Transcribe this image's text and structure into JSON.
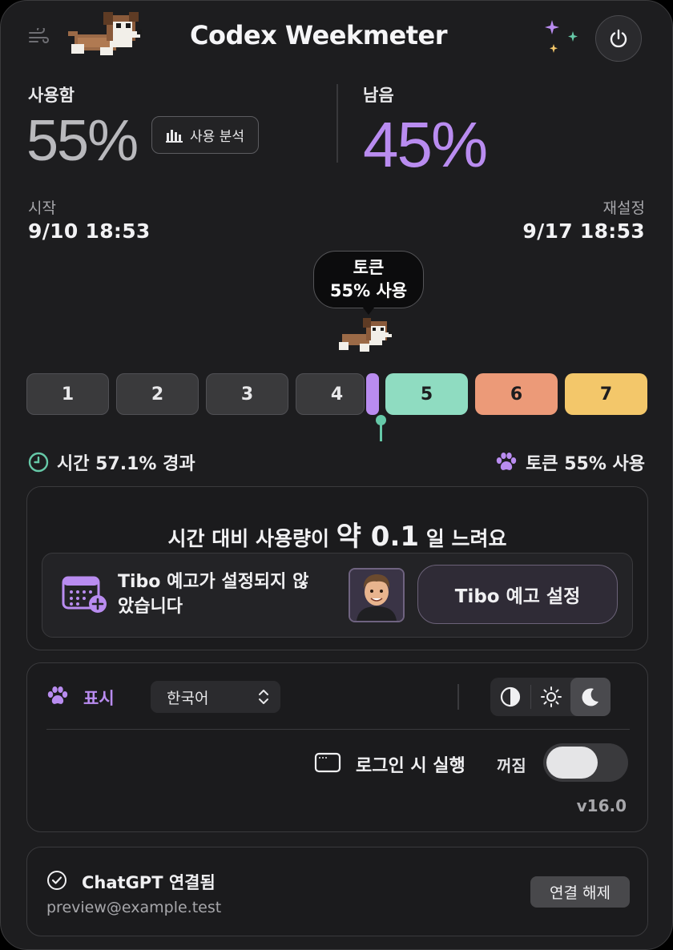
{
  "app": {
    "title": "Codex Weekmeter"
  },
  "usage": {
    "used_label": "사용함",
    "used_value": "55%",
    "analysis_button": "사용 분석",
    "remaining_label": "남음",
    "remaining_value": "45%"
  },
  "period": {
    "start_label": "시작",
    "start_value": "9/10 18:53",
    "reset_label": "재설정",
    "reset_value": "9/17 18:53"
  },
  "tooltip": {
    "line1": "토큰",
    "line2": "55% 사용"
  },
  "days": [
    {
      "label": "1",
      "state": "past",
      "color": "#3a3a3c"
    },
    {
      "label": "2",
      "state": "past",
      "color": "#3a3a3c"
    },
    {
      "label": "3",
      "state": "past",
      "color": "#3a3a3c"
    },
    {
      "label": "4",
      "state": "past",
      "color": "#3a3a3c"
    },
    {
      "label": "5",
      "state": "future",
      "color": "#8fdcc1"
    },
    {
      "label": "6",
      "state": "future",
      "color": "#ec9a78"
    },
    {
      "label": "7",
      "state": "future",
      "color": "#f3c76a"
    }
  ],
  "stats": {
    "time_text": "시간 57.1% 경과",
    "token_text": "토큰 55% 사용"
  },
  "pace": {
    "prefix": "시간 대비 사용량이",
    "multiplier": "약 0.1",
    "suffix": "일 느려요"
  },
  "tibo": {
    "message": "Tibo 예고가 설정되지 않았습니다",
    "button": "Tibo 예고 설정"
  },
  "settings": {
    "display_label": "표시",
    "language": "한국어",
    "theme_options": [
      "auto",
      "light",
      "dark"
    ],
    "theme_selected": "dark",
    "login_label": "로그인 시 실행",
    "login_state": "꺼짐",
    "version": "v16.0"
  },
  "account": {
    "status": "ChatGPT 연결됨",
    "email": "preview@example.test",
    "disconnect_button": "연결 해제"
  },
  "colors": {
    "accent_purple": "#b98cf0",
    "accent_green": "#66c9a8"
  }
}
